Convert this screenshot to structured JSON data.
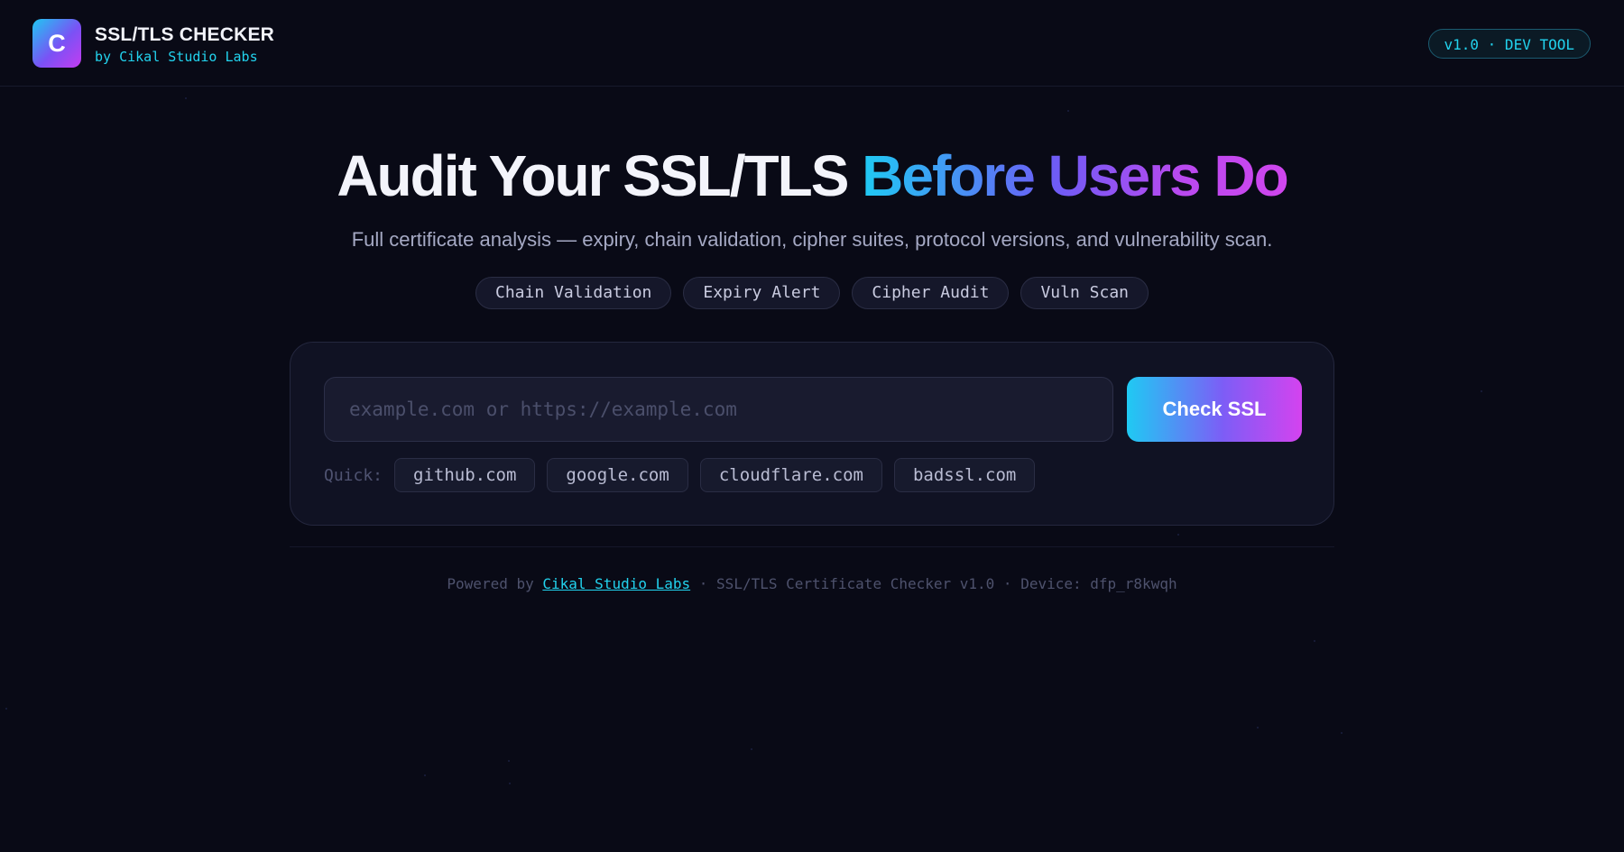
{
  "header": {
    "logo_letter": "C",
    "title": "SSL/TLS CHECKER",
    "subtitle": "by Cikal Studio Labs",
    "version_badge": "v1.0 · DEV TOOL"
  },
  "hero": {
    "title_plain": "Audit Your SSL/TLS ",
    "title_accent": "Before Users Do",
    "subtitle": "Full certificate analysis — expiry, chain validation, cipher suites, protocol versions, and vulnerability scan.",
    "features": [
      "Chain Validation",
      "Expiry Alert",
      "Cipher Audit",
      "Vuln Scan"
    ]
  },
  "search": {
    "value": "",
    "placeholder": "example.com or https://example.com",
    "button_label": "Check SSL",
    "quick_label": "Quick:",
    "quick_domains": [
      "github.com",
      "google.com",
      "cloudflare.com",
      "badssl.com"
    ]
  },
  "footer": {
    "prefix": "Powered by",
    "link_text": "Cikal Studio Labs",
    "suffix": "· SSL/TLS Certificate Checker v1.0 · Device: dfp_r8kwqh"
  },
  "colors": {
    "background": "#090a16",
    "accent_cyan": "#22d3ee",
    "accent_violet": "#7d5df6",
    "accent_magenta": "#d443ef"
  },
  "icons": {
    "logo": "letter-c-logo"
  }
}
